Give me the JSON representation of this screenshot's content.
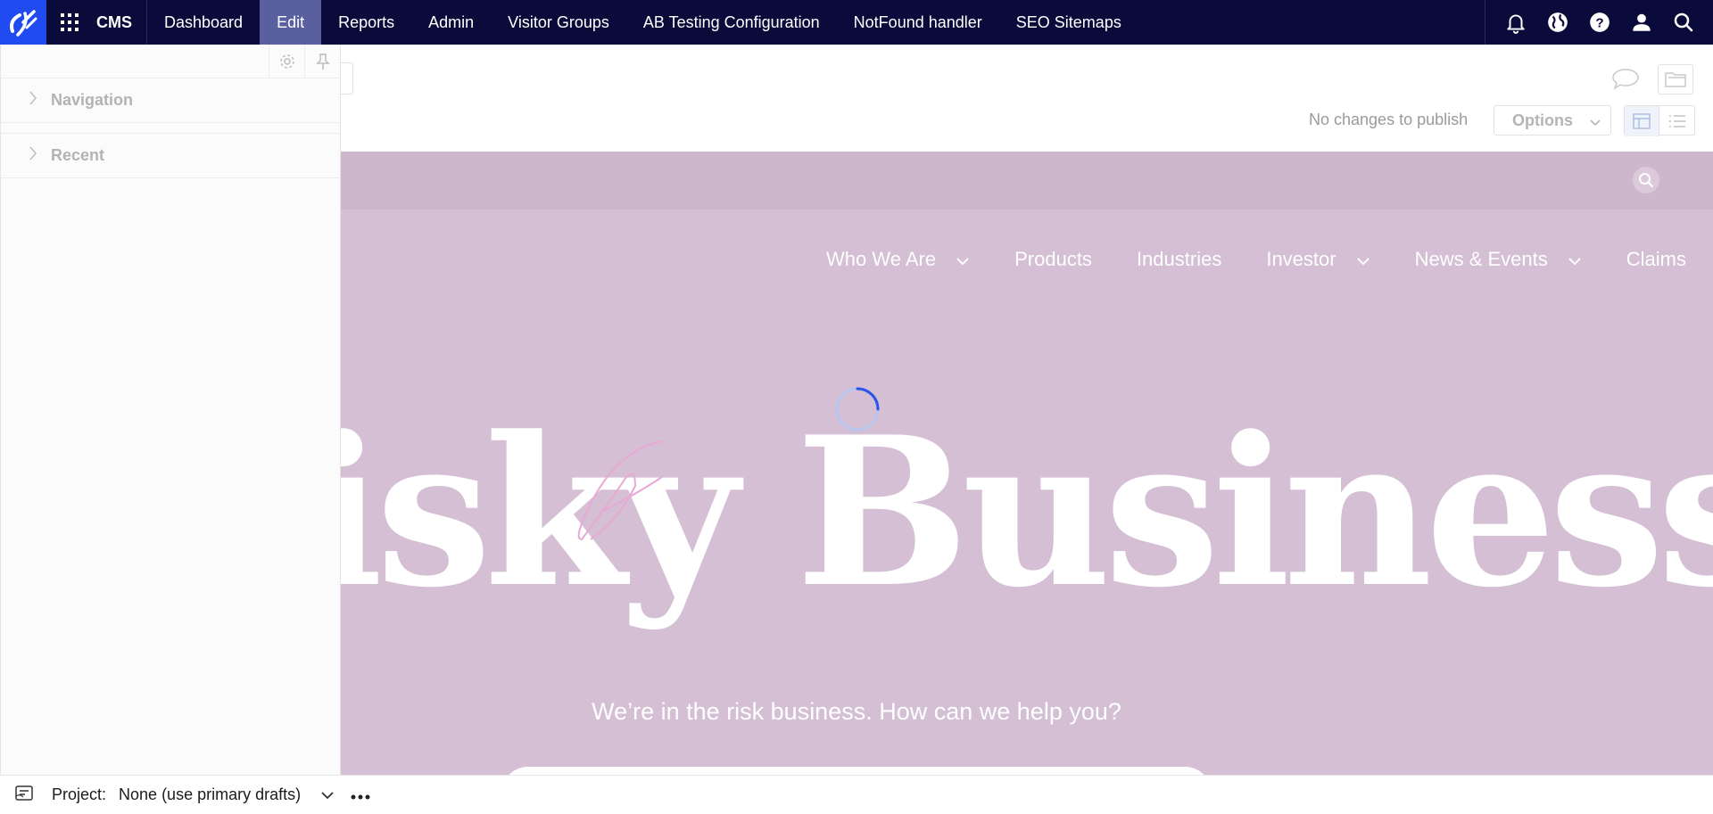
{
  "topnav": {
    "app_label": "CMS",
    "items": [
      {
        "label": "Dashboard",
        "active": false
      },
      {
        "label": "Edit",
        "active": true
      },
      {
        "label": "Reports",
        "active": false
      },
      {
        "label": "Admin",
        "active": false
      },
      {
        "label": "Visitor Groups",
        "active": false
      },
      {
        "label": "AB Testing Configuration",
        "active": false
      },
      {
        "label": "NotFound handler",
        "active": false
      },
      {
        "label": "SEO Sitemaps",
        "active": false
      }
    ],
    "right_icons": [
      "bell-icon",
      "globe-icon",
      "help-icon",
      "user-icon",
      "search-icon"
    ]
  },
  "toolbar": {
    "status": "No changes to publish",
    "options_label": "Options"
  },
  "left_panel": {
    "sections": [
      {
        "label": "Navigation"
      },
      {
        "label": "Recent"
      }
    ]
  },
  "preview": {
    "nav": [
      "Who We Are",
      "Products",
      "Industries",
      "Investor",
      "News & Events",
      "Claims"
    ],
    "hero_title": "isky Business",
    "hero_subtitle": "We’re in the risk business. How can we help you?"
  },
  "footer": {
    "project_label": "Project:",
    "project_value": "None (use primary drafts)"
  },
  "colors": {
    "topbar": "#0b0b3b",
    "logo_bg": "#1f4bf0",
    "active_tab": "#5a5fa0",
    "preview_bg": "#d4bfd4",
    "spinner": "#2b55e6"
  }
}
